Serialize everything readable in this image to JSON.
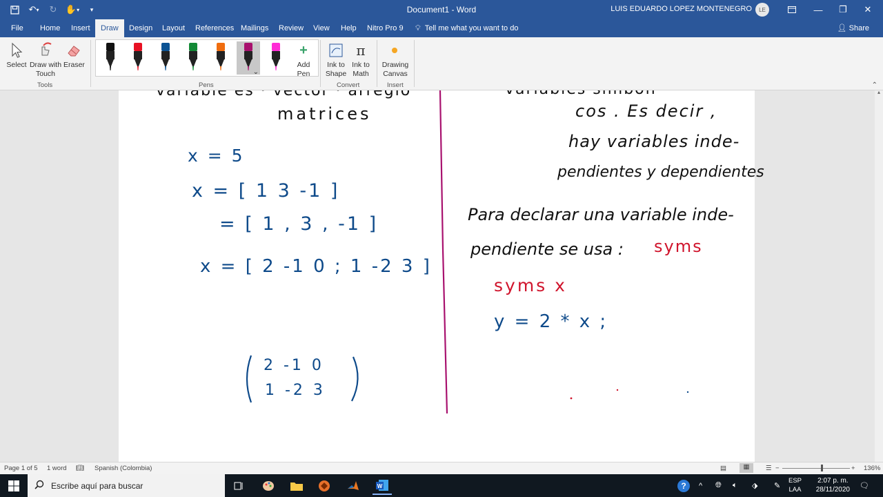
{
  "titlebar": {
    "doc_title": "Document1  -  Word",
    "user_name": "LUIS EDUARDO LOPEZ MONTENEGRO",
    "user_initials": "LE",
    "accent_color": "#2b579a"
  },
  "tabs": {
    "file": "File",
    "home": "Home",
    "insert": "Insert",
    "draw": "Draw",
    "design": "Design",
    "layout": "Layout",
    "references": "References",
    "mailings": "Mailings",
    "review": "Review",
    "view": "View",
    "help": "Help",
    "nitro": "Nitro Pro 9",
    "tell_me": "Tell me what you want to do",
    "share": "Share"
  },
  "ribbon": {
    "select_label": "Select",
    "draw_touch_label": "Draw with Touch",
    "eraser_label": "Eraser",
    "tools_group": "Tools",
    "pens_group": "Pens",
    "add_pen_label": "Add Pen",
    "ink_shape_label": "Ink to Shape",
    "ink_math_label": "Ink to Math",
    "convert_group": "Convert",
    "drawing_canvas_label": "Drawing Canvas",
    "insert_group": "Insert",
    "pen_colors": [
      "#111111",
      "#e81123",
      "#0b5394",
      "#138a36",
      "#f06d0f",
      "#a8116e",
      "#ff2bd6"
    ],
    "selected_pen_index": 5
  },
  "ink": {
    "left": {
      "top_partial": "variable es  ·  vector  ·  arreglo",
      "matrices": "matrices",
      "line1": "x = 5",
      "line2": "x = [ 1   3   -1 ]",
      "line3": "= [ 1 , 3 , -1 ]",
      "line4": "x = [ 2  -1   0 ; 1  -2  3 ]",
      "matrix_row1": "2   -1   0",
      "matrix_row2": "1   -2   3"
    },
    "right": {
      "top_partial": "variables  simboli-",
      "line1": "cos . Es decir ,",
      "line2": "hay  variables  inde-",
      "line3": "pendientes  y  dependientes",
      "line4": "Para  declarar una  variable  inde-",
      "line5": "pendiente  se usa :",
      "syms_keyword": "syms",
      "code1": "syms  x",
      "code2": "y = 2 * x ;"
    }
  },
  "status": {
    "page": "Page 1 of 5",
    "words": "1 word",
    "language": "Spanish (Colombia)",
    "zoom": "136%"
  },
  "taskbar": {
    "search_placeholder": "Escribe aquí para buscar",
    "lang_top": "ESP",
    "lang_bottom": "LAA",
    "time": "2:07 p. m.",
    "date": "28/11/2020"
  }
}
